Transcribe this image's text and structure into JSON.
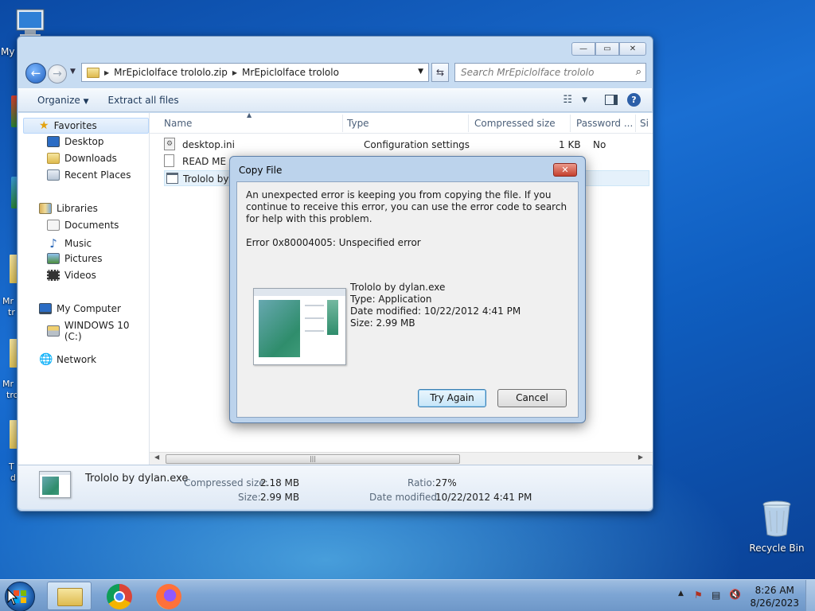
{
  "desktop": {
    "icons": [
      {
        "label": "My",
        "icon": "computer-icon"
      },
      {
        "label": "Recycle Bin",
        "icon": "recycle-bin-icon"
      }
    ],
    "partial_labels": [
      "Mr",
      "tr",
      "Mr",
      "tro",
      "T",
      "d"
    ]
  },
  "explorer": {
    "breadcrumb": [
      "MrEpiclolface trololo.zip",
      "MrEpiclolface trololo"
    ],
    "search_placeholder": "Search MrEpiclolface trololo",
    "toolbar": {
      "organize": "Organize",
      "extract": "Extract all files"
    },
    "nav": {
      "favorites": "Favorites",
      "favorite_items": [
        "Desktop",
        "Downloads",
        "Recent Places"
      ],
      "libraries": "Libraries",
      "library_items": [
        "Documents",
        "Music",
        "Pictures",
        "Videos"
      ],
      "computer": "My Computer",
      "drive": "WINDOWS 10 (C:)",
      "network": "Network"
    },
    "columns": [
      "Name",
      "Type",
      "Compressed size",
      "Password ...",
      "Si"
    ],
    "files": [
      {
        "name": "desktop.ini",
        "type": "Configuration settings",
        "compressed": "1 KB",
        "password": "No"
      },
      {
        "name": "READ ME !!!",
        "type": "",
        "compressed": "",
        "password": ""
      },
      {
        "name": "Trololo by d",
        "type": "",
        "compressed": "",
        "password": ""
      }
    ],
    "details": {
      "name": "Trololo by dylan.exe",
      "compressed_label": "Compressed size:",
      "compressed_value": "2.18 MB",
      "size_label": "Size:",
      "size_value": "2.99 MB",
      "ratio_label": "Ratio:",
      "ratio_value": "27%",
      "modified_label": "Date modified:",
      "modified_value": "10/22/2012 4:41 PM"
    }
  },
  "dialog": {
    "title": "Copy File",
    "message": "An unexpected error is keeping you from copying the file. If you continue to receive this error, you can use the error code to search for help with this problem.",
    "error": "Error 0x80004005: Unspecified error",
    "file_name": "Trololo by dylan.exe",
    "file_type": "Type: Application",
    "file_modified": "Date modified: 10/22/2012 4:41 PM",
    "file_size": "Size: 2.99 MB",
    "try_again": "Try Again",
    "cancel": "Cancel"
  },
  "taskbar": {
    "apps": [
      "explorer-icon",
      "chrome-icon",
      "firefox-icon"
    ],
    "time": "8:26 AM",
    "date": "8/26/2023"
  },
  "colors": {
    "accent": "#1f5fbf",
    "desktop": "#1a6fd3",
    "close_red": "#c4402e"
  }
}
